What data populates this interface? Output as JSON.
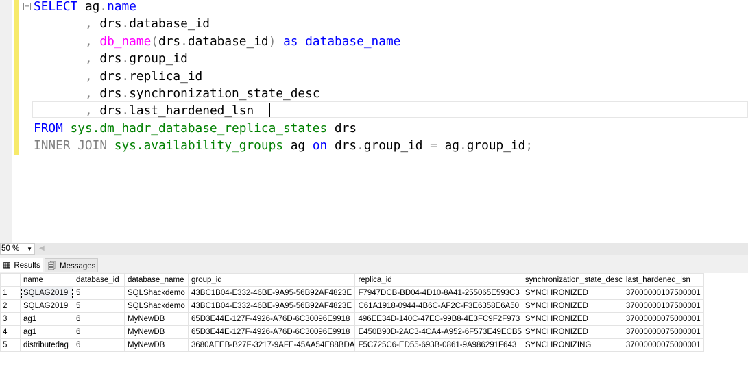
{
  "editor": {
    "lines": [
      {
        "indent": false,
        "tokens": [
          [
            "SELECT",
            "k"
          ],
          [
            " ag",
            "t"
          ],
          [
            ".",
            "g"
          ],
          [
            "name",
            "k"
          ]
        ]
      },
      {
        "indent": true,
        "tokens": [
          [
            ",",
            "g"
          ],
          [
            " drs",
            "t"
          ],
          [
            ".",
            "g"
          ],
          [
            "database_id",
            "t"
          ]
        ]
      },
      {
        "indent": true,
        "tokens": [
          [
            ",",
            "g"
          ],
          [
            " ",
            "t"
          ],
          [
            "db_name",
            "m"
          ],
          [
            "(",
            "g"
          ],
          [
            "drs",
            "t"
          ],
          [
            ".",
            "g"
          ],
          [
            "database_id",
            "t"
          ],
          [
            ")",
            "g"
          ],
          [
            " ",
            "t"
          ],
          [
            "as",
            "k"
          ],
          [
            " ",
            "t"
          ],
          [
            "database_name",
            "k"
          ]
        ]
      },
      {
        "indent": true,
        "tokens": [
          [
            ",",
            "g"
          ],
          [
            " drs",
            "t"
          ],
          [
            ".",
            "g"
          ],
          [
            "group_id",
            "t"
          ]
        ]
      },
      {
        "indent": true,
        "tokens": [
          [
            ",",
            "g"
          ],
          [
            " drs",
            "t"
          ],
          [
            ".",
            "g"
          ],
          [
            "replica_id",
            "t"
          ]
        ]
      },
      {
        "indent": true,
        "tokens": [
          [
            ",",
            "g"
          ],
          [
            " drs",
            "t"
          ],
          [
            ".",
            "g"
          ],
          [
            "synchronization_state_desc",
            "t"
          ]
        ]
      },
      {
        "indent": true,
        "tokens": [
          [
            ",",
            "g"
          ],
          [
            " drs",
            "t"
          ],
          [
            ".",
            "g"
          ],
          [
            "last_hardened_lsn",
            "t"
          ]
        ]
      },
      {
        "indent": false,
        "tokens": [
          [
            "FROM",
            "k"
          ],
          [
            " sys.dm_hadr_database_replica_states",
            "s"
          ],
          [
            " drs",
            "t"
          ]
        ]
      },
      {
        "indent": false,
        "tokens": [
          [
            "INNER JOIN",
            "g"
          ],
          [
            " sys.availability_groups",
            "s"
          ],
          [
            " ag ",
            "t"
          ],
          [
            "on",
            "k"
          ],
          [
            " drs",
            "t"
          ],
          [
            ".",
            "g"
          ],
          [
            "group_id ",
            "t"
          ],
          [
            "=",
            "g"
          ],
          [
            " ag",
            "t"
          ],
          [
            ".",
            "g"
          ],
          [
            "group_id",
            "t"
          ],
          [
            ";",
            "g"
          ]
        ]
      }
    ],
    "colors": {
      "keyword": "#0000ff",
      "operator": "#808080",
      "function": "#ff00ff",
      "system_object": "#008000",
      "change_bar": "#f7ea6a"
    }
  },
  "zoom": {
    "value": "50 %"
  },
  "tabs": [
    {
      "label": "Results",
      "icon": "grid-icon",
      "active": true
    },
    {
      "label": "Messages",
      "icon": "messages-icon",
      "active": false
    }
  ],
  "results": {
    "columns": [
      "name",
      "database_id",
      "database_name",
      "group_id",
      "replica_id",
      "synchronization_state_desc",
      "last_hardened_lsn"
    ],
    "rows": [
      [
        "1",
        "SQLAG2019",
        "5",
        "SQLShackdemo",
        "43BC1B04-E332-46BE-9A95-56B92AF4823E",
        "F7947DCB-BD04-4D10-8A41-255065E593C3",
        "SYNCHRONIZED",
        "37000000107500001"
      ],
      [
        "2",
        "SQLAG2019",
        "5",
        "SQLShackdemo",
        "43BC1B04-E332-46BE-9A95-56B92AF4823E",
        "C61A1918-0944-4B6C-AF2C-F3E6358E6A50",
        "SYNCHRONIZED",
        "37000000107500001"
      ],
      [
        "3",
        "ag1",
        "6",
        "MyNewDB",
        "65D3E44E-127F-4926-A76D-6C30096E9918",
        "496EE34D-140C-47EC-99B8-4E3FC9F2F973",
        "SYNCHRONIZED",
        "37000000075000001"
      ],
      [
        "4",
        "ag1",
        "6",
        "MyNewDB",
        "65D3E44E-127F-4926-A76D-6C30096E9918",
        "E450B90D-2AC3-4CA4-A952-6F573E49ECB5",
        "SYNCHRONIZED",
        "37000000075000001"
      ],
      [
        "5",
        "distributedag",
        "6",
        "MyNewDB",
        "3680AEEB-B27F-3217-9AFE-45AA54E88BDA",
        "F5C725C6-ED55-693B-0861-9A986291F643",
        "SYNCHRONIZING",
        "37000000075000001"
      ]
    ]
  }
}
